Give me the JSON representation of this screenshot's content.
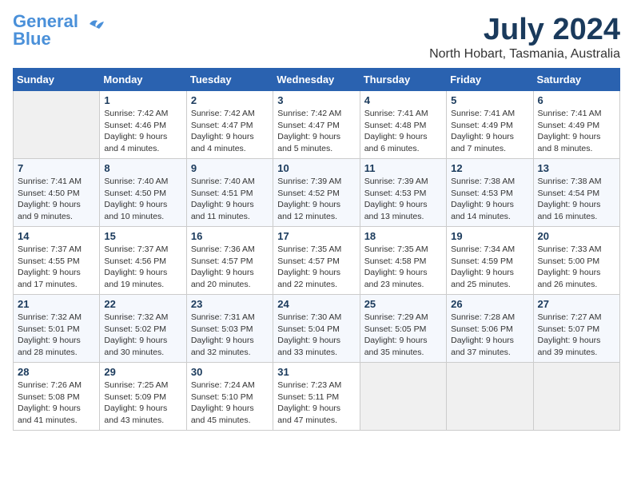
{
  "header": {
    "logo_line1": "General",
    "logo_line2": "Blue",
    "month_title": "July 2024",
    "location": "North Hobart, Tasmania, Australia"
  },
  "days_of_week": [
    "Sunday",
    "Monday",
    "Tuesday",
    "Wednesday",
    "Thursday",
    "Friday",
    "Saturday"
  ],
  "weeks": [
    [
      {
        "day": "",
        "info": ""
      },
      {
        "day": "1",
        "info": "Sunrise: 7:42 AM\nSunset: 4:46 PM\nDaylight: 9 hours\nand 4 minutes."
      },
      {
        "day": "2",
        "info": "Sunrise: 7:42 AM\nSunset: 4:47 PM\nDaylight: 9 hours\nand 4 minutes."
      },
      {
        "day": "3",
        "info": "Sunrise: 7:42 AM\nSunset: 4:47 PM\nDaylight: 9 hours\nand 5 minutes."
      },
      {
        "day": "4",
        "info": "Sunrise: 7:41 AM\nSunset: 4:48 PM\nDaylight: 9 hours\nand 6 minutes."
      },
      {
        "day": "5",
        "info": "Sunrise: 7:41 AM\nSunset: 4:49 PM\nDaylight: 9 hours\nand 7 minutes."
      },
      {
        "day": "6",
        "info": "Sunrise: 7:41 AM\nSunset: 4:49 PM\nDaylight: 9 hours\nand 8 minutes."
      }
    ],
    [
      {
        "day": "7",
        "info": "Sunrise: 7:41 AM\nSunset: 4:50 PM\nDaylight: 9 hours\nand 9 minutes."
      },
      {
        "day": "8",
        "info": "Sunrise: 7:40 AM\nSunset: 4:50 PM\nDaylight: 9 hours\nand 10 minutes."
      },
      {
        "day": "9",
        "info": "Sunrise: 7:40 AM\nSunset: 4:51 PM\nDaylight: 9 hours\nand 11 minutes."
      },
      {
        "day": "10",
        "info": "Sunrise: 7:39 AM\nSunset: 4:52 PM\nDaylight: 9 hours\nand 12 minutes."
      },
      {
        "day": "11",
        "info": "Sunrise: 7:39 AM\nSunset: 4:53 PM\nDaylight: 9 hours\nand 13 minutes."
      },
      {
        "day": "12",
        "info": "Sunrise: 7:38 AM\nSunset: 4:53 PM\nDaylight: 9 hours\nand 14 minutes."
      },
      {
        "day": "13",
        "info": "Sunrise: 7:38 AM\nSunset: 4:54 PM\nDaylight: 9 hours\nand 16 minutes."
      }
    ],
    [
      {
        "day": "14",
        "info": "Sunrise: 7:37 AM\nSunset: 4:55 PM\nDaylight: 9 hours\nand 17 minutes."
      },
      {
        "day": "15",
        "info": "Sunrise: 7:37 AM\nSunset: 4:56 PM\nDaylight: 9 hours\nand 19 minutes."
      },
      {
        "day": "16",
        "info": "Sunrise: 7:36 AM\nSunset: 4:57 PM\nDaylight: 9 hours\nand 20 minutes."
      },
      {
        "day": "17",
        "info": "Sunrise: 7:35 AM\nSunset: 4:57 PM\nDaylight: 9 hours\nand 22 minutes."
      },
      {
        "day": "18",
        "info": "Sunrise: 7:35 AM\nSunset: 4:58 PM\nDaylight: 9 hours\nand 23 minutes."
      },
      {
        "day": "19",
        "info": "Sunrise: 7:34 AM\nSunset: 4:59 PM\nDaylight: 9 hours\nand 25 minutes."
      },
      {
        "day": "20",
        "info": "Sunrise: 7:33 AM\nSunset: 5:00 PM\nDaylight: 9 hours\nand 26 minutes."
      }
    ],
    [
      {
        "day": "21",
        "info": "Sunrise: 7:32 AM\nSunset: 5:01 PM\nDaylight: 9 hours\nand 28 minutes."
      },
      {
        "day": "22",
        "info": "Sunrise: 7:32 AM\nSunset: 5:02 PM\nDaylight: 9 hours\nand 30 minutes."
      },
      {
        "day": "23",
        "info": "Sunrise: 7:31 AM\nSunset: 5:03 PM\nDaylight: 9 hours\nand 32 minutes."
      },
      {
        "day": "24",
        "info": "Sunrise: 7:30 AM\nSunset: 5:04 PM\nDaylight: 9 hours\nand 33 minutes."
      },
      {
        "day": "25",
        "info": "Sunrise: 7:29 AM\nSunset: 5:05 PM\nDaylight: 9 hours\nand 35 minutes."
      },
      {
        "day": "26",
        "info": "Sunrise: 7:28 AM\nSunset: 5:06 PM\nDaylight: 9 hours\nand 37 minutes."
      },
      {
        "day": "27",
        "info": "Sunrise: 7:27 AM\nSunset: 5:07 PM\nDaylight: 9 hours\nand 39 minutes."
      }
    ],
    [
      {
        "day": "28",
        "info": "Sunrise: 7:26 AM\nSunset: 5:08 PM\nDaylight: 9 hours\nand 41 minutes."
      },
      {
        "day": "29",
        "info": "Sunrise: 7:25 AM\nSunset: 5:09 PM\nDaylight: 9 hours\nand 43 minutes."
      },
      {
        "day": "30",
        "info": "Sunrise: 7:24 AM\nSunset: 5:10 PM\nDaylight: 9 hours\nand 45 minutes."
      },
      {
        "day": "31",
        "info": "Sunrise: 7:23 AM\nSunset: 5:11 PM\nDaylight: 9 hours\nand 47 minutes."
      },
      {
        "day": "",
        "info": ""
      },
      {
        "day": "",
        "info": ""
      },
      {
        "day": "",
        "info": ""
      }
    ]
  ]
}
